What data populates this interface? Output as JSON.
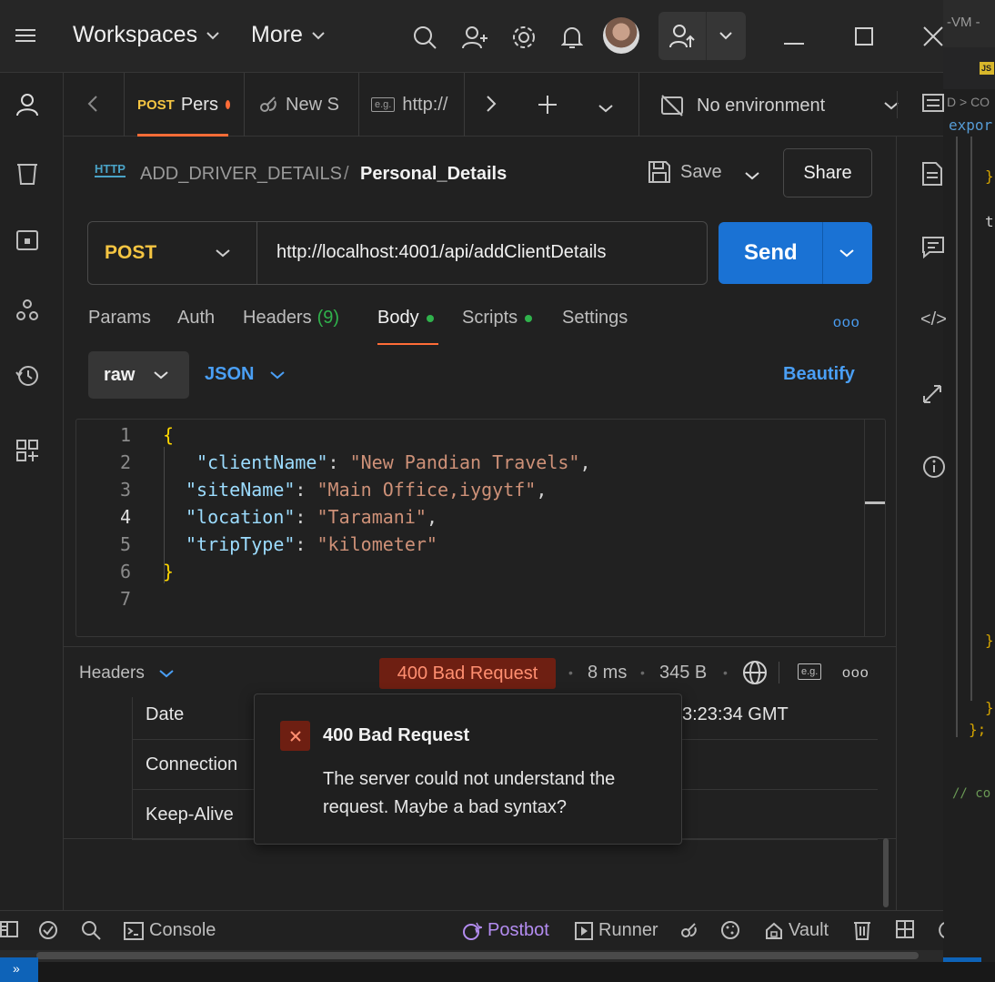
{
  "topbar": {
    "workspaces_label": "Workspaces",
    "more_label": "More"
  },
  "tabs": [
    {
      "method": "POST",
      "label": "Pers"
    },
    {
      "label": "New S"
    },
    {
      "label": "http://"
    }
  ],
  "environment": {
    "label": "No environment"
  },
  "request": {
    "protocol_badge": "HTTP",
    "breadcrumb_collection": "ADD_DRIVER_DETAILS",
    "breadcrumb_separator": "/",
    "name": "Personal_Details",
    "save_label": "Save",
    "share_label": "Share",
    "method": "POST",
    "url": "http://localhost:4001/api/addClientDetails",
    "send_label": "Send"
  },
  "subtabs": {
    "params": "Params",
    "auth": "Auth",
    "headers": "Headers",
    "headers_count": "(9)",
    "body": "Body",
    "scripts": "Scripts",
    "settings": "Settings"
  },
  "body_options": {
    "mode": "raw",
    "format": "JSON",
    "beautify": "Beautify"
  },
  "editor": {
    "line_numbers": [
      "1",
      "2",
      "3",
      "4",
      "5",
      "6",
      "7"
    ],
    "open_brace": "{",
    "close_brace": "}",
    "lines": [
      {
        "key": "\"clientName\"",
        "value": "\"New Pandian Travels\"",
        "trail": ","
      },
      {
        "key": "\"siteName\"",
        "value": "\"Main Office,iygytf\"",
        "trail": ","
      },
      {
        "key": "\"location\"",
        "value": "\"Taramani\"",
        "trail": ","
      },
      {
        "key": "\"tripType\"",
        "value": "\"kilometer\"",
        "trail": ""
      }
    ]
  },
  "response": {
    "section_label": "Headers",
    "status": "400 Bad Request",
    "time": "8 ms",
    "size": "345 B",
    "headers": [
      {
        "name": "Date",
        "value": "3:23:34 GMT"
      },
      {
        "name": "Connection",
        "value": ""
      },
      {
        "name": "Keep-Alive",
        "value": ""
      }
    ]
  },
  "tooltip": {
    "title": "400 Bad Request",
    "message_line1": "The server could not understand the",
    "message_line2": "request. Maybe a bad syntax?"
  },
  "statusbar": {
    "console": "Console",
    "postbot": "Postbot",
    "runner": "Runner",
    "vault": "Vault"
  },
  "vscode": {
    "title_fragment": "-VM -",
    "js_badge": "JS",
    "breadcrumb": "D > CO",
    "export_text": "expor"
  },
  "colors": {
    "accent_orange": "#ff6c37",
    "send_blue": "#1a72d4",
    "method_yellow": "#f5c542",
    "link_blue": "#4a9ff5",
    "status_error_bg": "#6e1f12",
    "status_error_text": "#ff8f70",
    "dot_green": "#30b24c"
  }
}
